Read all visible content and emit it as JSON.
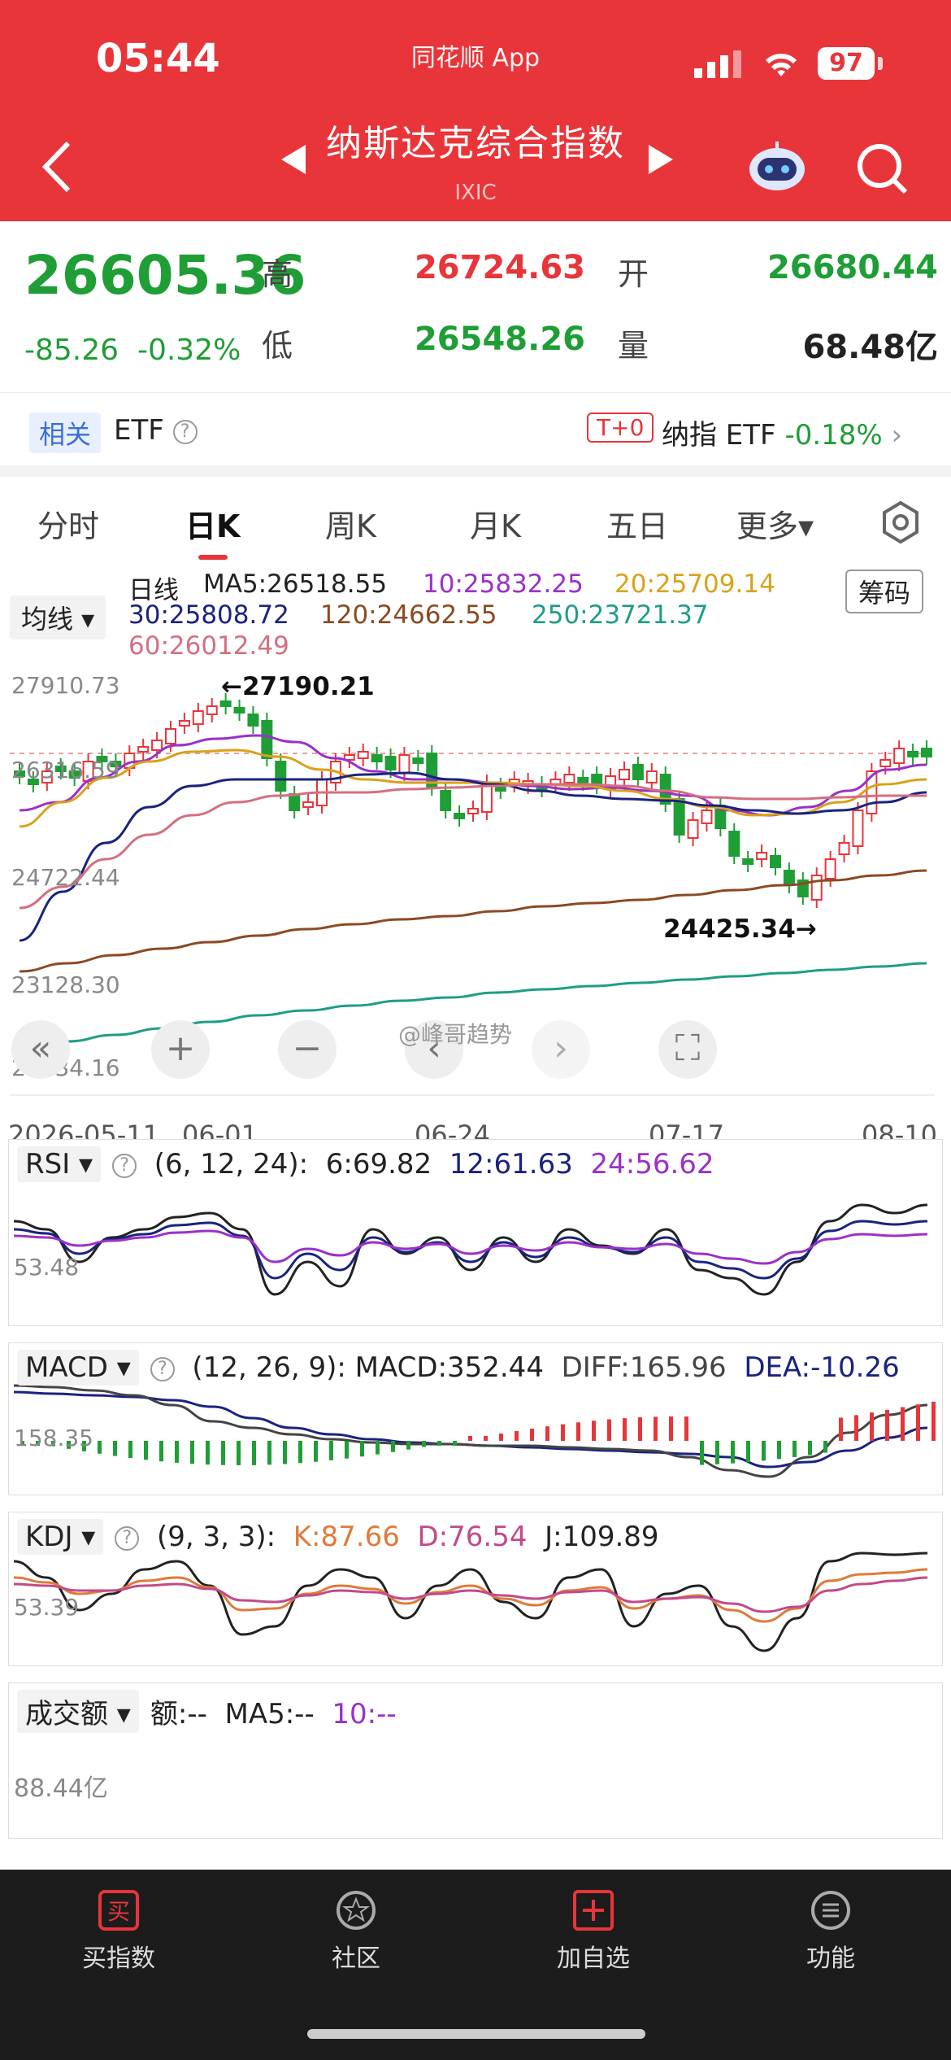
{
  "status": {
    "time": "05:44",
    "app": "同花顺 App",
    "battery": "97"
  },
  "header": {
    "title": "纳斯达克综合指数",
    "subtitle": "IXIC"
  },
  "quote": {
    "price": "26605.36",
    "change": "-85.26",
    "change_pct": "-0.32%",
    "high_label": "高",
    "high": "26724.63",
    "open_label": "开",
    "open": "26680.44",
    "low_label": "低",
    "low": "26548.26",
    "vol_label": "量",
    "volume": "68.48亿"
  },
  "etf": {
    "tag": "相关",
    "label": "ETF",
    "t0": "T+0",
    "name": "纳指 ETF",
    "pct": "-0.18%"
  },
  "tabs": [
    "分时",
    "日K",
    "周K",
    "月K",
    "五日",
    "更多▾"
  ],
  "ma": {
    "selector": "均线 ▾",
    "cycle": "日线",
    "ma5": "MA5:26518.55",
    "ma10": "10:25832.25",
    "ma20": "20:25709.14",
    "ma30": "30:25808.72",
    "ma120": "120:24662.55",
    "ma250": "250:23721.37",
    "ma60": "60:26012.49",
    "chip": "筹码"
  },
  "chart_data": {
    "type": "candlestick",
    "y_ticks": [
      "27910.73",
      "26316.59",
      "24722.44",
      "23128.30",
      "21534.16"
    ],
    "x_ticks": [
      "2026-05-11",
      "06-01",
      "06-24",
      "07-17",
      "08-10"
    ],
    "annotations": [
      "←27190.21",
      "24425.34→"
    ]
  },
  "watermark": "@峰哥趋势",
  "indicators": {
    "rsi": {
      "name": "RSI ▾",
      "params": "(6, 12, 24):",
      "v1": "6:69.82",
      "v2": "12:61.63",
      "v3": "24:56.62",
      "axis": "53.48"
    },
    "macd": {
      "name": "MACD ▾",
      "params": "(12, 26, 9):",
      "v1": "MACD:352.44",
      "v2": "DIFF:165.96",
      "v3": "DEA:-10.26",
      "axis": "158.35"
    },
    "kdj": {
      "name": "KDJ ▾",
      "params": "(9, 3, 3):",
      "v1": "K:87.66",
      "v2": "D:76.54",
      "v3": "J:109.89",
      "axis": "53.39"
    },
    "amount": {
      "name": "成交额 ▾",
      "v1": "额:--",
      "v2": "MA5:--",
      "v3": "10:--",
      "axis": "88.44亿"
    }
  },
  "colors": {
    "up": "#e8353a",
    "down": "#1f9e36",
    "brand": "#e8353a"
  },
  "nav": [
    {
      "label": "买指数",
      "icon": "buy-icon"
    },
    {
      "label": "社区",
      "icon": "community-icon"
    },
    {
      "label": "加自选",
      "icon": "add-watchlist-icon"
    },
    {
      "label": "功能",
      "icon": "menu-icon"
    }
  ]
}
